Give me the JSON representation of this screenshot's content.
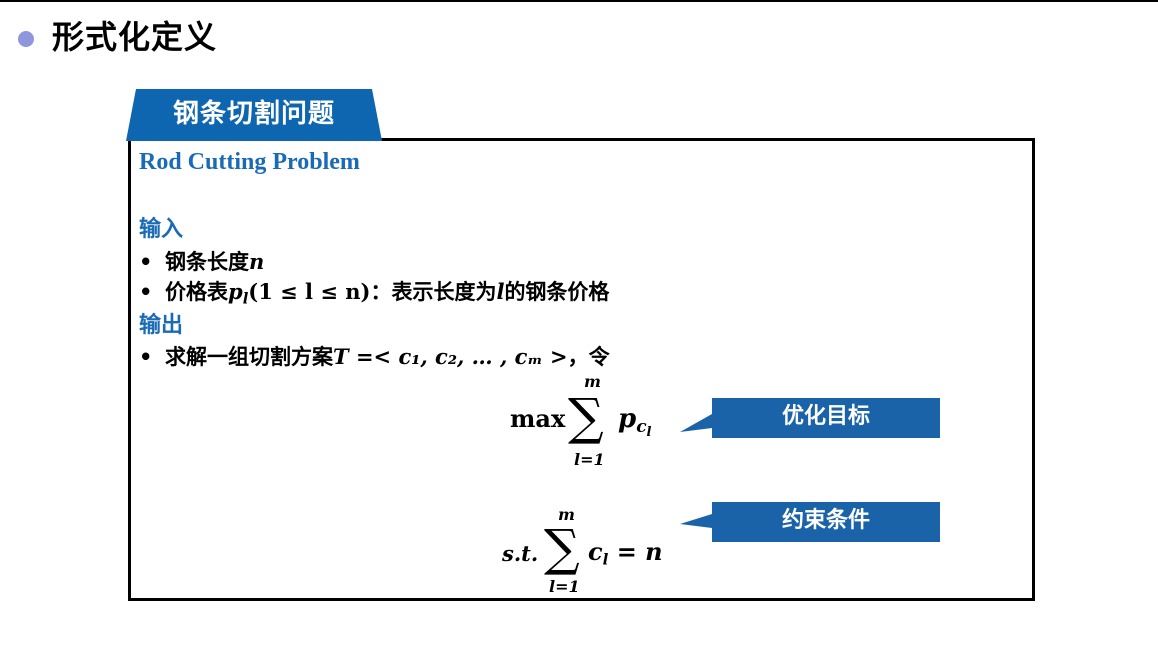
{
  "slide": {
    "title": "形式化定义"
  },
  "box": {
    "tab_label": "钢条切割问题",
    "english_title": "Rod Cutting Problem",
    "input_heading": "输入",
    "input_items": [
      {
        "text": "钢条长度",
        "math": "n"
      },
      {
        "text_before": "价格表",
        "math_p": "p",
        "math_sub": "l",
        "math_range": "(1 ≤ l ≤ n)",
        "text_after_1": "：表示长度为",
        "math_l": "l",
        "text_after_2": "的钢条价格"
      }
    ],
    "output_heading": "输出",
    "output_item": {
      "text": "求解一组切割方案",
      "math": "T =< c₁, c₂, … , cₘ >",
      "text_after": "，令"
    },
    "objective": {
      "op": "max",
      "upper": "m",
      "lower": "l=1",
      "term": "p",
      "term_sub": "c",
      "term_subsub": "l",
      "label": "优化目标"
    },
    "constraint": {
      "prefix": "s.t.",
      "upper": "m",
      "lower": "l=1",
      "term": "c",
      "term_sub": "l",
      "rhs": "= n",
      "label": "约束条件"
    }
  },
  "colors": {
    "accent_blue": "#1a6bb5",
    "tab_blue": "#0f66b0",
    "callout_blue": "#1b63a8",
    "bullet_purple": "#8f96dd"
  }
}
